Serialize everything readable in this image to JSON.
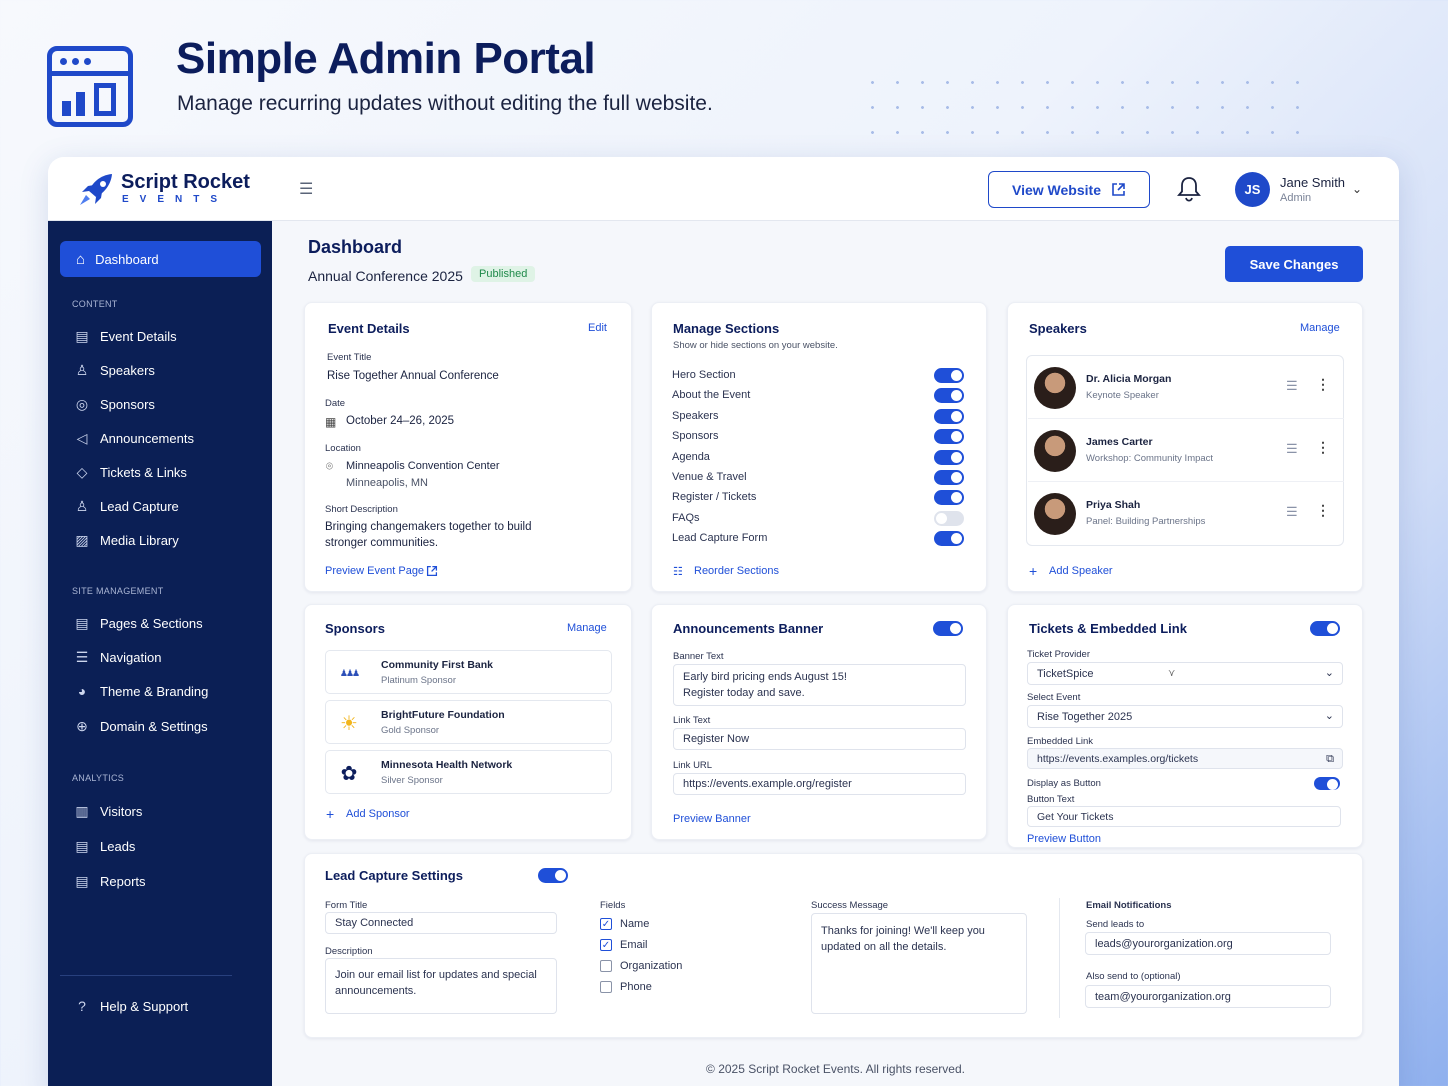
{
  "hero": {
    "title": "Simple Admin Portal",
    "subtitle": "Manage recurring updates without editing the full website."
  },
  "topbar": {
    "brand": "Script Rocket",
    "brand_sub": "EVENTS",
    "view_website": "View Website",
    "user_initials": "JS",
    "user_name": "Jane Smith",
    "user_role": "Admin"
  },
  "sidebar": {
    "dashboard": "Dashboard",
    "content_label": "CONTENT",
    "content": [
      "Event Details",
      "Speakers",
      "Sponsors",
      "Announcements",
      "Tickets & Links",
      "Lead Capture",
      "Media Library"
    ],
    "site_label": "SITE MANAGEMENT",
    "site": [
      "Pages & Sections",
      "Navigation",
      "Theme & Branding",
      "Domain & Settings"
    ],
    "analytics_label": "ANALYTICS",
    "analytics": [
      "Visitors",
      "Leads",
      "Reports"
    ],
    "help": "Help & Support"
  },
  "page": {
    "title": "Dashboard",
    "event": "Annual Conference 2025",
    "status": "Published",
    "save": "Save Changes"
  },
  "event_details": {
    "title": "Event Details",
    "edit": "Edit",
    "event_title_label": "Event Title",
    "event_title": "Rise Together Annual Conference",
    "date_label": "Date",
    "date": "October 24–26, 2025",
    "location_label": "Location",
    "location_1": "Minneapolis Convention Center",
    "location_2": "Minneapolis, MN",
    "desc_label": "Short Description",
    "desc_1": "Bringing changemakers together to build",
    "desc_2": "stronger communities.",
    "preview": "Preview Event Page"
  },
  "sections": {
    "title": "Manage Sections",
    "subtitle": "Show or hide sections on your website.",
    "items": [
      {
        "label": "Hero Section",
        "on": true
      },
      {
        "label": "About the Event",
        "on": true
      },
      {
        "label": "Speakers",
        "on": true
      },
      {
        "label": "Sponsors",
        "on": true
      },
      {
        "label": "Agenda",
        "on": true
      },
      {
        "label": "Venue & Travel",
        "on": true
      },
      {
        "label": "Register / Tickets",
        "on": true
      },
      {
        "label": "FAQs",
        "on": false
      },
      {
        "label": "Lead Capture Form",
        "on": true
      }
    ],
    "reorder": "Reorder Sections"
  },
  "speakers": {
    "title": "Speakers",
    "manage": "Manage",
    "items": [
      {
        "name": "Dr. Alicia Morgan",
        "role": "Keynote Speaker"
      },
      {
        "name": "James Carter",
        "role": "Workshop: Community Impact"
      },
      {
        "name": "Priya Shah",
        "role": "Panel: Building Partnerships"
      }
    ],
    "add": "Add Speaker"
  },
  "sponsors": {
    "title": "Sponsors",
    "manage": "Manage",
    "items": [
      {
        "name": "Community First Bank",
        "tier": "Platinum Sponsor",
        "icon": "people-icon",
        "color": "#2c4fb8"
      },
      {
        "name": "BrightFuture Foundation",
        "tier": "Gold Sponsor",
        "icon": "sun-icon",
        "color": "#f2b51c"
      },
      {
        "name": "Minnesota Health Network",
        "tier": "Silver Sponsor",
        "icon": "flower-icon",
        "color": "#0c1d5c"
      }
    ],
    "add": "Add Sponsor"
  },
  "banner": {
    "title": "Announcements Banner",
    "enabled": true,
    "text_label": "Banner Text",
    "text_1": "Early bird pricing ends August 15!",
    "text_2": "Register today and save.",
    "link_text_label": "Link Text",
    "link_text": "Register Now",
    "link_url_label": "Link URL",
    "link_url": "https://events.example.org/register",
    "preview": "Preview Banner"
  },
  "tickets": {
    "title": "Tickets & Embedded Link",
    "enabled": true,
    "provider_label": "Ticket Provider",
    "provider": "TicketSpice",
    "event_label": "Select Event",
    "event": "Rise Together 2025",
    "embed_label": "Embedded Link",
    "embed": "https://events.examples.org/tickets",
    "display_button_label": "Display as Button",
    "display_button": true,
    "button_text_label": "Button Text",
    "button_text": "Get Your Tickets",
    "preview": "Preview Button"
  },
  "lead": {
    "title": "Lead Capture Settings",
    "enabled": true,
    "form_title_label": "Form Title",
    "form_title": "Stay Connected",
    "desc_label": "Description",
    "desc_1": "Join our email list for updates and special",
    "desc_2": "announcements.",
    "fields_label": "Fields",
    "fields": [
      {
        "label": "Name",
        "checked": true
      },
      {
        "label": "Email",
        "checked": true
      },
      {
        "label": "Organization",
        "checked": false
      },
      {
        "label": "Phone",
        "checked": false
      }
    ],
    "success_label": "Success Message",
    "success_1": "Thanks for joining! We'll keep you",
    "success_2": "updated on all the details.",
    "email_label": "Email Notifications",
    "send_label": "Send leads to",
    "send": "leads@yourorganization.org",
    "also_label": "Also send to (optional)",
    "also": "team@yourorganization.org"
  },
  "footer": "© 2025 Script Rocket Events. All rights reserved.",
  "colors": {
    "primary": "#1f4fd8",
    "navy": "#0b1f55",
    "title": "#0c1d5c",
    "published_bg": "#dff3e6"
  }
}
